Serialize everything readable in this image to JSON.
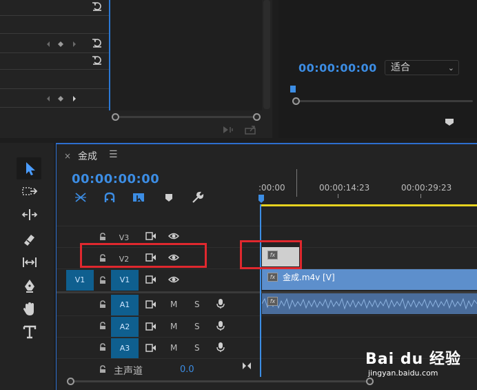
{
  "program_monitor": {
    "timecode": "00:00:00:00",
    "fit_label": "适合"
  },
  "sequence": {
    "name": "金成",
    "menu_glyph": "☰",
    "close_glyph": "×",
    "timecode": "00:00:00:00"
  },
  "ruler": {
    "labels": [
      ":00:00",
      "00:00:14:23",
      "00:00:29:23"
    ]
  },
  "tracks": {
    "video": [
      {
        "name": "V3",
        "source": ""
      },
      {
        "name": "V2",
        "source": ""
      },
      {
        "name": "V1",
        "source": "V1"
      }
    ],
    "audio": [
      {
        "name": "A1",
        "m": "M",
        "s": "S"
      },
      {
        "name": "A2",
        "m": "M",
        "s": "S"
      },
      {
        "name": "A3",
        "m": "M",
        "s": "S"
      }
    ],
    "master": {
      "label": "主声道",
      "value": "0.0"
    }
  },
  "clips": {
    "v1_label": "金成.m4v [V]",
    "fx": "fx"
  },
  "watermark": {
    "brand": "Bai du 经验",
    "url": "jingyan.baidu.com"
  },
  "colors": {
    "accent": "#3c8de4",
    "highlight": "#e0282e",
    "work_area": "#e6d21e",
    "track_target": "#0f5f8f",
    "clip_video": "#5d8fcc"
  }
}
